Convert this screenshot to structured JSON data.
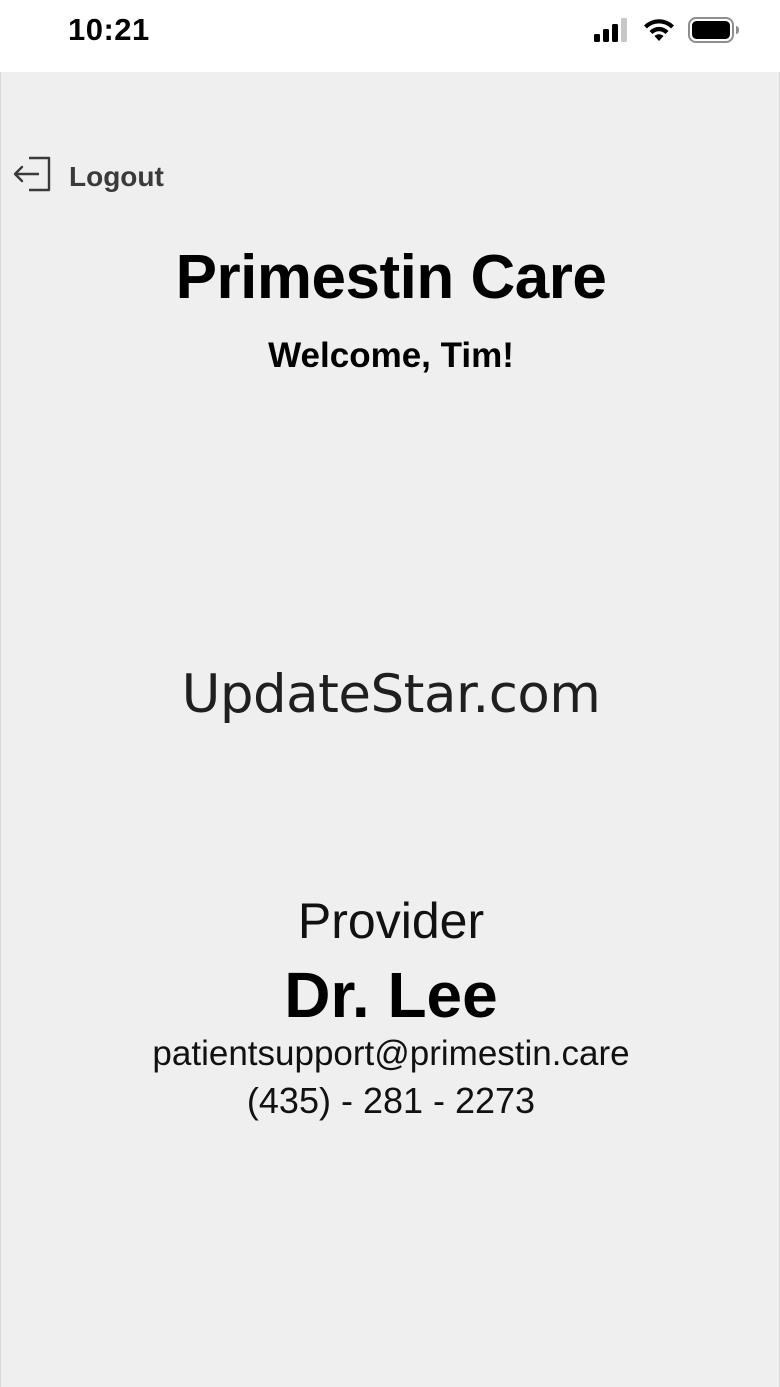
{
  "status_bar": {
    "time": "10:21",
    "icons": [
      "signal-icon",
      "wifi-icon",
      "battery-icon"
    ]
  },
  "header": {
    "logout_label": "Logout",
    "logout_icon": "logout-icon",
    "app_title": "Primestin Care",
    "welcome": "Welcome, Tim!"
  },
  "watermark": {
    "text": "UpdateStar.com"
  },
  "provider": {
    "label": "Provider",
    "name": "Dr. Lee",
    "email": "patientsupport@primestin.care",
    "phone": "(435) - 281 - 2273"
  },
  "colors": {
    "background": "#efefef",
    "status_bar": "#ffffff",
    "text": "#000000"
  }
}
